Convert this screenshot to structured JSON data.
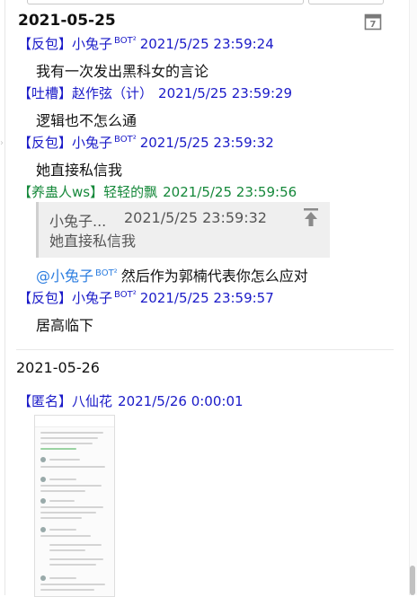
{
  "header": {
    "date": "2021-05-25",
    "calendar_icon": "calendar-icon"
  },
  "messages": [
    {
      "tag": "【反包】",
      "user": "小兔子",
      "bot": "BOT²",
      "time": "2021/5/25 23:59:24",
      "text": "我有一次发出黑科女的言论"
    },
    {
      "tag": "【吐槽】",
      "user": "赵作弦（计）",
      "time": "2021/5/25 23:59:29",
      "text": "逻辑也不怎么通"
    },
    {
      "tag": "【反包】",
      "user": "小兔子",
      "bot": "BOT²",
      "time": "2021/5/25 23:59:32",
      "text": "她直接私信我"
    },
    {
      "tag": "【养蛊人ws】",
      "user": "轻轻的飘",
      "time": "2021/5/25 23:59:56"
    },
    {
      "tag": "【反包】",
      "user": "小兔子",
      "bot": "BOT²",
      "time": "2021/5/25 23:59:57",
      "text": "居高临下"
    }
  ],
  "quote": {
    "user": "小兔子...",
    "time": "2021/5/25 23:59:32",
    "text": "她直接私信我",
    "pin_icon": "pin-top-icon"
  },
  "reply": {
    "mention": "@小兔子",
    "bot": "BOT²",
    "text": "然后作为郭楠代表你怎么应对"
  },
  "day2": {
    "date": "2021-05-26",
    "tag": "【匿名】",
    "user": "八仙花",
    "time": "2021/5/26 0:00:01"
  },
  "colors": {
    "tag_blue": "#1a1ac8",
    "tag_green": "#15883a",
    "mention": "#2b7de0",
    "quote_bg": "#efefef"
  }
}
